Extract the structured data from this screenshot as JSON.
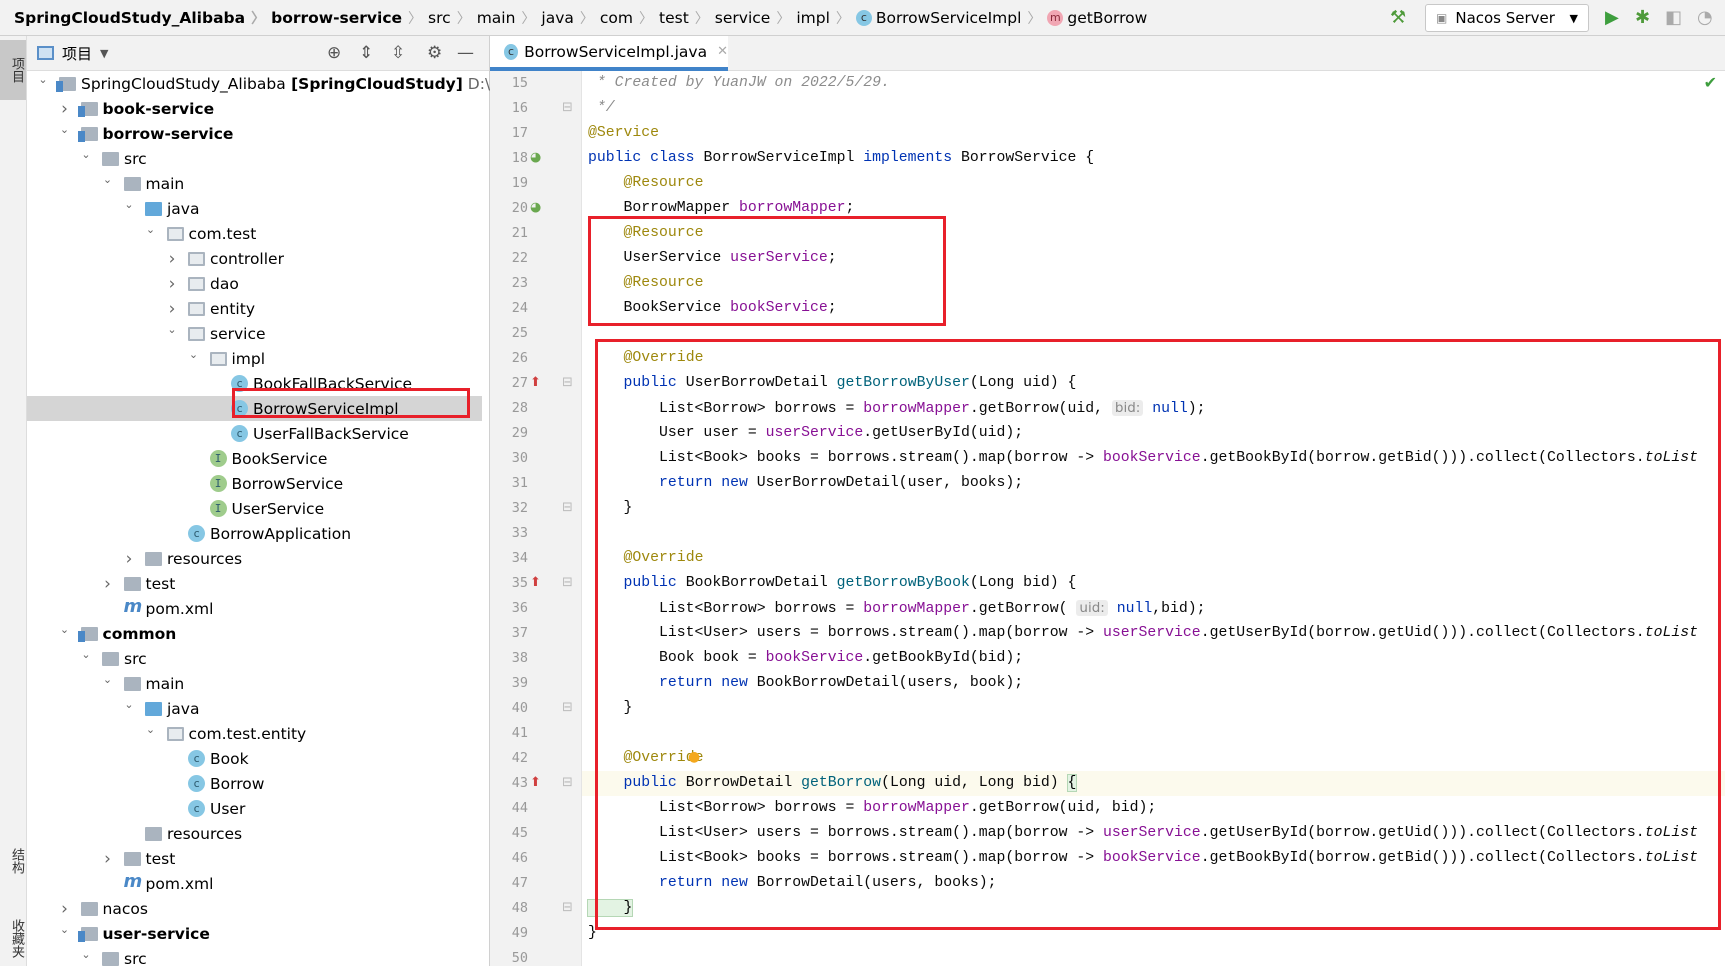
{
  "breadcrumb": [
    {
      "label": "SpringCloudStudy_Alibaba",
      "bold": true
    },
    {
      "label": "borrow-service",
      "bold": true
    },
    {
      "label": "src"
    },
    {
      "label": "main"
    },
    {
      "label": "java"
    },
    {
      "label": "com"
    },
    {
      "label": "test"
    },
    {
      "label": "service"
    },
    {
      "label": "impl"
    },
    {
      "label": "BorrowServiceImpl",
      "badge": "c"
    },
    {
      "label": "getBorrow",
      "badge": "m"
    }
  ],
  "toolbar": {
    "run_config": "Nacos Server",
    "icons": [
      "build-hammer-icon",
      "run-icon",
      "debug-icon",
      "coverage-icon",
      "profile-icon"
    ]
  },
  "left_stripe": {
    "project_tab": "项目",
    "structure_tab": "结构",
    "favorites_tab": "收藏夹"
  },
  "project_panel": {
    "title": "项目"
  },
  "tree": [
    {
      "depth": 0,
      "arrow": "open",
      "icon": "module",
      "label": "SpringCloudStudy_Alibaba",
      "bold_suffix": "[SpringCloudStudy]",
      "extra": "D:\\User"
    },
    {
      "depth": 1,
      "arrow": "closed",
      "icon": "module",
      "label": "book-service",
      "bold": true
    },
    {
      "depth": 1,
      "arrow": "open",
      "icon": "module",
      "label": "borrow-service",
      "bold": true
    },
    {
      "depth": 2,
      "arrow": "open",
      "icon": "folder",
      "label": "src"
    },
    {
      "depth": 3,
      "arrow": "open",
      "icon": "folder",
      "label": "main"
    },
    {
      "depth": 4,
      "arrow": "open",
      "icon": "folder-blue",
      "label": "java"
    },
    {
      "depth": 5,
      "arrow": "open",
      "icon": "package",
      "label": "com.test"
    },
    {
      "depth": 6,
      "arrow": "closed",
      "icon": "package",
      "label": "controller"
    },
    {
      "depth": 6,
      "arrow": "closed",
      "icon": "package",
      "label": "dao"
    },
    {
      "depth": 6,
      "arrow": "closed",
      "icon": "package",
      "label": "entity"
    },
    {
      "depth": 6,
      "arrow": "open",
      "icon": "package",
      "label": "service"
    },
    {
      "depth": 7,
      "arrow": "open",
      "icon": "package",
      "label": "impl"
    },
    {
      "depth": 8,
      "icon": "class",
      "label": "BookFallBackService"
    },
    {
      "depth": 8,
      "icon": "class",
      "label": "BorrowServiceImpl",
      "selected": true
    },
    {
      "depth": 8,
      "icon": "class",
      "label": "UserFallBackService"
    },
    {
      "depth": 7,
      "icon": "interface",
      "label": "BookService"
    },
    {
      "depth": 7,
      "icon": "interface",
      "label": "BorrowService"
    },
    {
      "depth": 7,
      "icon": "interface",
      "label": "UserService"
    },
    {
      "depth": 6,
      "icon": "app",
      "label": "BorrowApplication"
    },
    {
      "depth": 4,
      "arrow": "closed",
      "icon": "resources",
      "label": "resources"
    },
    {
      "depth": 3,
      "arrow": "closed",
      "icon": "folder",
      "label": "test"
    },
    {
      "depth": 3,
      "icon": "maven",
      "label": "pom.xml"
    },
    {
      "depth": 1,
      "arrow": "open",
      "icon": "module",
      "label": "common",
      "bold": true
    },
    {
      "depth": 2,
      "arrow": "open",
      "icon": "folder",
      "label": "src"
    },
    {
      "depth": 3,
      "arrow": "open",
      "icon": "folder",
      "label": "main"
    },
    {
      "depth": 4,
      "arrow": "open",
      "icon": "folder-blue",
      "label": "java"
    },
    {
      "depth": 5,
      "arrow": "open",
      "icon": "package",
      "label": "com.test.entity"
    },
    {
      "depth": 6,
      "icon": "class",
      "label": "Book"
    },
    {
      "depth": 6,
      "icon": "class",
      "label": "Borrow"
    },
    {
      "depth": 6,
      "icon": "class",
      "label": "User"
    },
    {
      "depth": 4,
      "icon": "resources",
      "label": "resources"
    },
    {
      "depth": 3,
      "arrow": "closed",
      "icon": "folder",
      "label": "test"
    },
    {
      "depth": 3,
      "icon": "maven",
      "label": "pom.xml"
    },
    {
      "depth": 1,
      "arrow": "closed",
      "icon": "folder",
      "label": "nacos"
    },
    {
      "depth": 1,
      "arrow": "open",
      "icon": "module",
      "label": "user-service",
      "bold": true
    },
    {
      "depth": 2,
      "arrow": "open",
      "icon": "folder",
      "label": "src"
    }
  ],
  "editor": {
    "tab_label": "BorrowServiceImpl.java",
    "first_line": 15,
    "current_line": 43,
    "lines": [
      [
        [
          "c",
          " * Created by YuanJW on 2022/5/29."
        ]
      ],
      [
        [
          "c",
          " */"
        ]
      ],
      [
        [
          "a",
          "@Service"
        ]
      ],
      [
        [
          "k",
          "public class "
        ],
        [
          "t",
          "BorrowServiceImpl "
        ],
        [
          "k",
          "implements "
        ],
        [
          "t",
          "BorrowService {"
        ]
      ],
      [
        [
          "t",
          "    "
        ],
        [
          "a",
          "@Resource"
        ]
      ],
      [
        [
          "t",
          "    BorrowMapper "
        ],
        [
          "f",
          "borrowMapper"
        ],
        [
          "t",
          ";"
        ]
      ],
      [
        [
          "t",
          "    "
        ],
        [
          "a",
          "@Resource"
        ]
      ],
      [
        [
          "t",
          "    UserService "
        ],
        [
          "f",
          "userService"
        ],
        [
          "t",
          ";"
        ]
      ],
      [
        [
          "t",
          "    "
        ],
        [
          "a",
          "@Resource"
        ]
      ],
      [
        [
          "t",
          "    BookService "
        ],
        [
          "f",
          "bookService"
        ],
        [
          "t",
          ";"
        ]
      ],
      [],
      [
        [
          "t",
          "    "
        ],
        [
          "a",
          "@Override"
        ]
      ],
      [
        [
          "t",
          "    "
        ],
        [
          "k",
          "public "
        ],
        [
          "t",
          "UserBorrowDetail "
        ],
        [
          "d",
          "getBorrowByUser"
        ],
        [
          "t",
          "(Long uid) {"
        ]
      ],
      [
        [
          "t",
          "        List<Borrow> borrows = "
        ],
        [
          "f",
          "borrowMapper"
        ],
        [
          "t",
          ".getBorrow(uid, "
        ],
        [
          "h",
          "bid:"
        ],
        [
          "t",
          " "
        ],
        [
          "k",
          "null"
        ],
        [
          "t",
          ");"
        ]
      ],
      [
        [
          "t",
          "        User user = "
        ],
        [
          "f",
          "userService"
        ],
        [
          "t",
          ".getUserById(uid);"
        ]
      ],
      [
        [
          "t",
          "        List<Book> books = borrows.stream().map(borrow -> "
        ],
        [
          "f",
          "bookService"
        ],
        [
          "t",
          ".getBookById(borrow.getBid())).collect(Collectors."
        ],
        [
          "i",
          "toList"
        ]
      ],
      [
        [
          "t",
          "        "
        ],
        [
          "k",
          "return new "
        ],
        [
          "t",
          "UserBorrowDetail(user, books);"
        ]
      ],
      [
        [
          "t",
          "    }"
        ]
      ],
      [],
      [
        [
          "t",
          "    "
        ],
        [
          "a",
          "@Override"
        ]
      ],
      [
        [
          "t",
          "    "
        ],
        [
          "k",
          "public "
        ],
        [
          "t",
          "BookBorrowDetail "
        ],
        [
          "d",
          "getBorrowByBook"
        ],
        [
          "t",
          "(Long bid) {"
        ]
      ],
      [
        [
          "t",
          "        List<Borrow> borrows = "
        ],
        [
          "f",
          "borrowMapper"
        ],
        [
          "t",
          ".getBorrow( "
        ],
        [
          "h",
          "uid:"
        ],
        [
          "t",
          " "
        ],
        [
          "k",
          "null"
        ],
        [
          "t",
          ",bid);"
        ]
      ],
      [
        [
          "t",
          "        List<User> users = borrows.stream().map(borrow -> "
        ],
        [
          "f",
          "userService"
        ],
        [
          "t",
          ".getUserById(borrow.getUid())).collect(Collectors."
        ],
        [
          "i",
          "toList"
        ]
      ],
      [
        [
          "t",
          "        Book book = "
        ],
        [
          "f",
          "bookService"
        ],
        [
          "t",
          ".getBookById(bid);"
        ]
      ],
      [
        [
          "t",
          "        "
        ],
        [
          "k",
          "return new "
        ],
        [
          "t",
          "BookBorrowDetail(users, book);"
        ]
      ],
      [
        [
          "t",
          "    }"
        ]
      ],
      [],
      [
        [
          "t",
          "    "
        ],
        [
          "a",
          "@Override"
        ]
      ],
      [
        [
          "t",
          "    "
        ],
        [
          "k",
          "public "
        ],
        [
          "t",
          "BorrowDetail "
        ],
        [
          "d",
          "getBorrow"
        ],
        [
          "t",
          "(Long uid, Long bid) "
        ],
        [
          "b",
          "{"
        ]
      ],
      [
        [
          "t",
          "        List<Borrow> borrows = "
        ],
        [
          "f",
          "borrowMapper"
        ],
        [
          "t",
          ".getBorrow(uid, bid);"
        ]
      ],
      [
        [
          "t",
          "        List<User> users = borrows.stream().map(borrow -> "
        ],
        [
          "f",
          "userService"
        ],
        [
          "t",
          ".getUserById(borrow.getUid())).collect(Collectors."
        ],
        [
          "i",
          "toList"
        ]
      ],
      [
        [
          "t",
          "        List<Book> books = borrows.stream().map(borrow -> "
        ],
        [
          "f",
          "bookService"
        ],
        [
          "t",
          ".getBookById(borrow.getBid())).collect(Collectors."
        ],
        [
          "i",
          "toList"
        ]
      ],
      [
        [
          "t",
          "        "
        ],
        [
          "k",
          "return new "
        ],
        [
          "t",
          "BorrowDetail(users, books);"
        ]
      ],
      [
        [
          "b",
          "    }"
        ]
      ],
      [
        [
          "t",
          "}"
        ]
      ],
      []
    ]
  },
  "colors": {
    "highlight_box": "#e8202a",
    "tab_underline": "#4083c9",
    "annotation": "#9e880d",
    "keyword": "#0033b3",
    "field": "#871094"
  }
}
